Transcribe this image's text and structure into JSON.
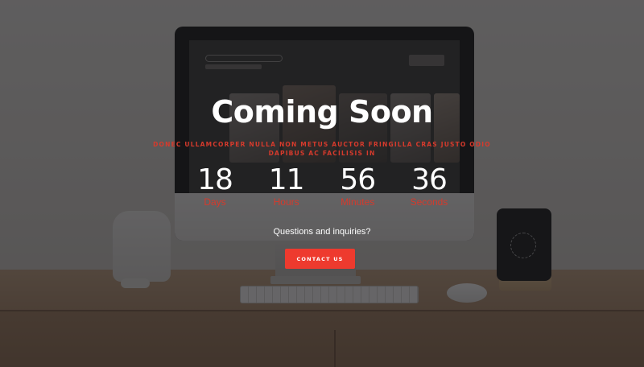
{
  "hero": {
    "title": "Coming Soon",
    "subtitle": "Donec ullamcorper nulla non metus auctor fringilla cras justo odio dapibus ac facilisis in"
  },
  "countdown": [
    {
      "value": "18",
      "label": "Days"
    },
    {
      "value": "11",
      "label": "Hours"
    },
    {
      "value": "56",
      "label": "Minutes"
    },
    {
      "value": "36",
      "label": "Seconds"
    }
  ],
  "contact": {
    "prompt": "Questions and inquiries?",
    "button_label": "CONTACT US"
  },
  "colors": {
    "accent": "#ee3a2e",
    "label_red": "#d63a2c",
    "text": "#ffffff",
    "overlay": "#141416"
  }
}
